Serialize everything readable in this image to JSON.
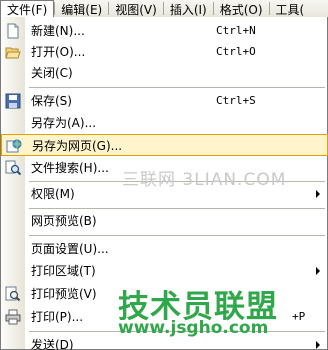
{
  "menubar": {
    "file": "文件(F)",
    "edit": "编辑(E)",
    "view": "视图(V)",
    "insert": "插入(I)",
    "format": "格式(O)",
    "tools": "工具("
  },
  "menu": {
    "new": {
      "label": "新建(N)...",
      "shortcut": "Ctrl+N",
      "icon": "new-document-icon"
    },
    "open": {
      "label": "打开(O)...",
      "shortcut": "Ctrl+O",
      "icon": "open-folder-icon"
    },
    "close": {
      "label": "关闭(C)"
    },
    "save": {
      "label": "保存(S)",
      "shortcut": "Ctrl+S",
      "icon": "save-disk-icon"
    },
    "save_as": {
      "label": "另存为(A)..."
    },
    "save_as_web": {
      "label": "另存为网页(G)...",
      "icon": "web-page-icon"
    },
    "file_search": {
      "label": "文件搜索(H)...",
      "icon": "file-search-icon"
    },
    "permission": {
      "label": "权限(M)"
    },
    "web_preview": {
      "label": "网页预览(B)"
    },
    "page_setup": {
      "label": "页面设置(U)..."
    },
    "print_area": {
      "label": "打印区域(T)"
    },
    "print_preview": {
      "label": "打印预览(V)",
      "icon": "print-preview-icon"
    },
    "print": {
      "label": "打印(P)...",
      "shortcut": "+P",
      "icon": "printer-icon"
    },
    "send": {
      "label": "发送(D)"
    }
  },
  "watermark": {
    "line1": "三联网 3LIAN.COM",
    "line2": "技术员联盟",
    "line3": "www.jsgho.com"
  },
  "colors": {
    "highlight_bg": "#fff4cc",
    "highlight_border": "#e0a300",
    "watermark_green": "#2fa74a"
  }
}
